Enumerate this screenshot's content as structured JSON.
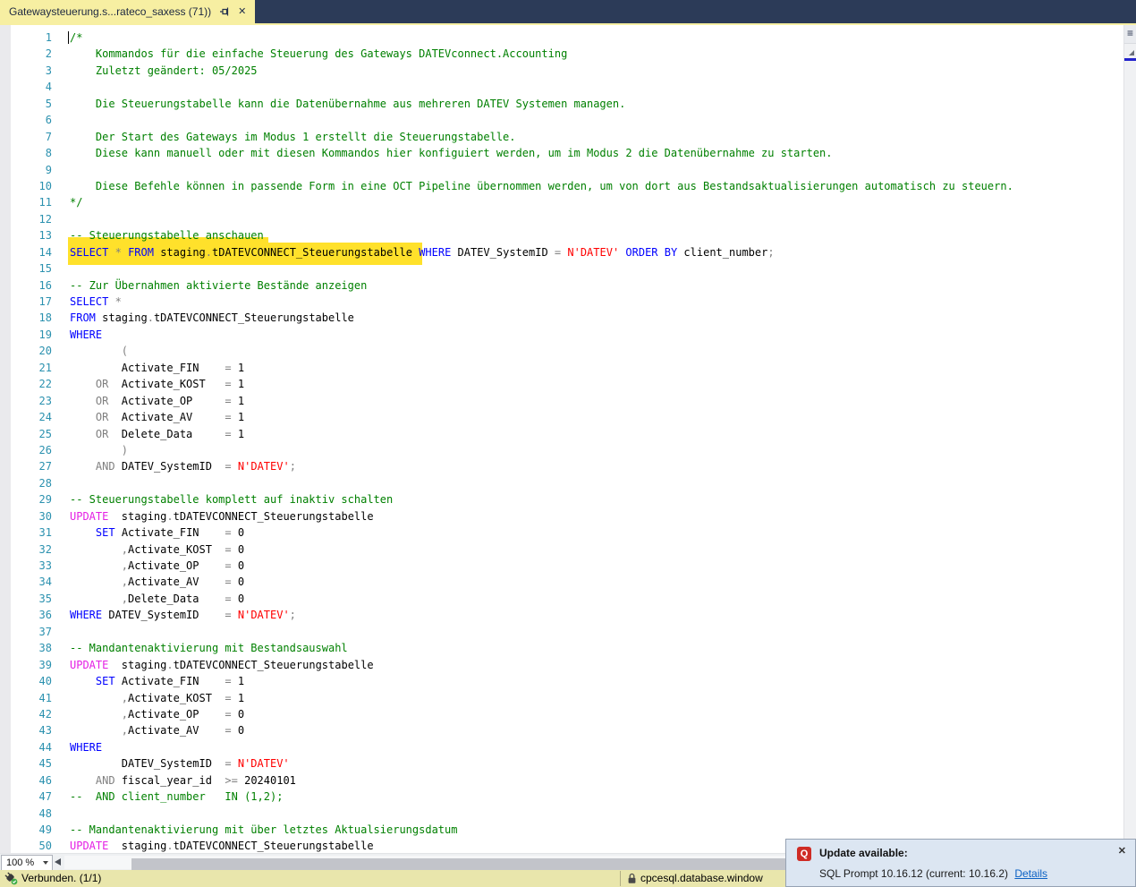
{
  "tab": {
    "title": "Gatewaysteuerung.s...rateco_saxess (71))",
    "close_glyph": "✕"
  },
  "editor": {
    "zoom_level": "100 %",
    "annotations": {
      "highlighted_line": 14
    },
    "lines": [
      {
        "n": 1,
        "t": [
          [
            "c",
            "/*"
          ]
        ]
      },
      {
        "n": 2,
        "t": [
          [
            "c",
            "    Kommandos für die einfache Steuerung des Gateways DATEVconnect.Accounting"
          ]
        ]
      },
      {
        "n": 3,
        "t": [
          [
            "c",
            "    Zuletzt geändert: 05/2025"
          ]
        ]
      },
      {
        "n": 4,
        "t": []
      },
      {
        "n": 5,
        "t": [
          [
            "c",
            "    Die Steuerungstabelle kann die Datenübernahme aus mehreren DATEV Systemen managen."
          ]
        ]
      },
      {
        "n": 6,
        "t": []
      },
      {
        "n": 7,
        "t": [
          [
            "c",
            "    Der Start des Gateways im Modus 1 erstellt die Steuerungstabelle."
          ]
        ]
      },
      {
        "n": 8,
        "t": [
          [
            "c",
            "    Diese kann manuell oder mit diesen Kommandos hier konfiguiert werden, um im Modus 2 die Datenübernahme zu starten."
          ]
        ]
      },
      {
        "n": 9,
        "t": []
      },
      {
        "n": 10,
        "t": [
          [
            "c",
            "    Diese Befehle können in passende Form in eine OCT Pipeline übernommen werden, um von dort aus Bestandsaktualisierungen automatisch zu steuern."
          ]
        ]
      },
      {
        "n": 11,
        "t": [
          [
            "c",
            "*/"
          ]
        ]
      },
      {
        "n": 12,
        "t": []
      },
      {
        "n": 13,
        "t": [
          [
            "c",
            "-- Steuerungstabelle anschauen"
          ]
        ]
      },
      {
        "n": 14,
        "t": [
          [
            "k",
            "SELECT"
          ],
          [
            "t",
            " "
          ],
          [
            "o",
            "*"
          ],
          [
            "t",
            " "
          ],
          [
            "k",
            "FROM"
          ],
          [
            "t",
            " staging"
          ],
          [
            "o",
            "."
          ],
          [
            "t",
            "tDATEVCONNECT_Steuerungstabelle "
          ],
          [
            "k",
            "WHERE"
          ],
          [
            "t",
            " DATEV_SystemID "
          ],
          [
            "o",
            "="
          ],
          [
            "t",
            " "
          ],
          [
            "s",
            "N'DATEV'"
          ],
          [
            "t",
            " "
          ],
          [
            "k",
            "ORDER BY"
          ],
          [
            "t",
            " client_number"
          ],
          [
            "o",
            ";"
          ]
        ]
      },
      {
        "n": 15,
        "t": []
      },
      {
        "n": 16,
        "t": [
          [
            "c",
            "-- Zur Übernahmen aktivierte Bestände anzeigen"
          ]
        ]
      },
      {
        "n": 17,
        "t": [
          [
            "k",
            "SELECT"
          ],
          [
            "t",
            " "
          ],
          [
            "o",
            "*"
          ]
        ]
      },
      {
        "n": 18,
        "t": [
          [
            "k",
            "FROM"
          ],
          [
            "t",
            " staging"
          ],
          [
            "o",
            "."
          ],
          [
            "t",
            "tDATEVCONNECT_Steuerungstabelle"
          ]
        ]
      },
      {
        "n": 19,
        "t": [
          [
            "k",
            "WHERE"
          ]
        ]
      },
      {
        "n": 20,
        "t": [
          [
            "t",
            "        "
          ],
          [
            "o",
            "("
          ]
        ]
      },
      {
        "n": 21,
        "t": [
          [
            "t",
            "        Activate_FIN    "
          ],
          [
            "o",
            "="
          ],
          [
            "t",
            " 1"
          ]
        ]
      },
      {
        "n": 22,
        "t": [
          [
            "t",
            "    "
          ],
          [
            "o",
            "OR"
          ],
          [
            "t",
            "  Activate_KOST   "
          ],
          [
            "o",
            "="
          ],
          [
            "t",
            " 1"
          ]
        ]
      },
      {
        "n": 23,
        "t": [
          [
            "t",
            "    "
          ],
          [
            "o",
            "OR"
          ],
          [
            "t",
            "  Activate_OP     "
          ],
          [
            "o",
            "="
          ],
          [
            "t",
            " 1"
          ]
        ]
      },
      {
        "n": 24,
        "t": [
          [
            "t",
            "    "
          ],
          [
            "o",
            "OR"
          ],
          [
            "t",
            "  Activate_AV     "
          ],
          [
            "o",
            "="
          ],
          [
            "t",
            " 1"
          ]
        ]
      },
      {
        "n": 25,
        "t": [
          [
            "t",
            "    "
          ],
          [
            "o",
            "OR"
          ],
          [
            "t",
            "  Delete_Data     "
          ],
          [
            "o",
            "="
          ],
          [
            "t",
            " 1"
          ]
        ]
      },
      {
        "n": 26,
        "t": [
          [
            "t",
            "        "
          ],
          [
            "o",
            ")"
          ]
        ]
      },
      {
        "n": 27,
        "t": [
          [
            "t",
            "    "
          ],
          [
            "o",
            "AND"
          ],
          [
            "t",
            " DATEV_SystemID  "
          ],
          [
            "o",
            "="
          ],
          [
            "t",
            " "
          ],
          [
            "s",
            "N'DATEV'"
          ],
          [
            "o",
            ";"
          ]
        ]
      },
      {
        "n": 28,
        "t": []
      },
      {
        "n": 29,
        "t": [
          [
            "c",
            "-- Steuerungstabelle komplett auf inaktiv schalten"
          ]
        ]
      },
      {
        "n": 30,
        "t": [
          [
            "m",
            "UPDATE"
          ],
          [
            "t",
            "  staging"
          ],
          [
            "o",
            "."
          ],
          [
            "t",
            "tDATEVCONNECT_Steuerungstabelle"
          ]
        ]
      },
      {
        "n": 31,
        "t": [
          [
            "t",
            "    "
          ],
          [
            "k",
            "SET"
          ],
          [
            "t",
            " Activate_FIN    "
          ],
          [
            "o",
            "="
          ],
          [
            "t",
            " 0"
          ]
        ]
      },
      {
        "n": 32,
        "t": [
          [
            "t",
            "        "
          ],
          [
            "o",
            ","
          ],
          [
            "t",
            "Activate_KOST  "
          ],
          [
            "o",
            "="
          ],
          [
            "t",
            " 0"
          ]
        ]
      },
      {
        "n": 33,
        "t": [
          [
            "t",
            "        "
          ],
          [
            "o",
            ","
          ],
          [
            "t",
            "Activate_OP    "
          ],
          [
            "o",
            "="
          ],
          [
            "t",
            " 0"
          ]
        ]
      },
      {
        "n": 34,
        "t": [
          [
            "t",
            "        "
          ],
          [
            "o",
            ","
          ],
          [
            "t",
            "Activate_AV    "
          ],
          [
            "o",
            "="
          ],
          [
            "t",
            " 0"
          ]
        ]
      },
      {
        "n": 35,
        "t": [
          [
            "t",
            "        "
          ],
          [
            "o",
            ","
          ],
          [
            "t",
            "Delete_Data    "
          ],
          [
            "o",
            "="
          ],
          [
            "t",
            " 0"
          ]
        ]
      },
      {
        "n": 36,
        "t": [
          [
            "k",
            "WHERE"
          ],
          [
            "t",
            " DATEV_SystemID    "
          ],
          [
            "o",
            "="
          ],
          [
            "t",
            " "
          ],
          [
            "s",
            "N'DATEV'"
          ],
          [
            "o",
            ";"
          ]
        ]
      },
      {
        "n": 37,
        "t": []
      },
      {
        "n": 38,
        "t": [
          [
            "c",
            "-- Mandantenaktivierung mit Bestandsauswahl"
          ]
        ]
      },
      {
        "n": 39,
        "t": [
          [
            "m",
            "UPDATE"
          ],
          [
            "t",
            "  staging"
          ],
          [
            "o",
            "."
          ],
          [
            "t",
            "tDATEVCONNECT_Steuerungstabelle"
          ]
        ]
      },
      {
        "n": 40,
        "t": [
          [
            "t",
            "    "
          ],
          [
            "k",
            "SET"
          ],
          [
            "t",
            " Activate_FIN    "
          ],
          [
            "o",
            "="
          ],
          [
            "t",
            " 1"
          ]
        ]
      },
      {
        "n": 41,
        "t": [
          [
            "t",
            "        "
          ],
          [
            "o",
            ","
          ],
          [
            "t",
            "Activate_KOST  "
          ],
          [
            "o",
            "="
          ],
          [
            "t",
            " 1"
          ]
        ]
      },
      {
        "n": 42,
        "t": [
          [
            "t",
            "        "
          ],
          [
            "o",
            ","
          ],
          [
            "t",
            "Activate_OP    "
          ],
          [
            "o",
            "="
          ],
          [
            "t",
            " 0"
          ]
        ]
      },
      {
        "n": 43,
        "t": [
          [
            "t",
            "        "
          ],
          [
            "o",
            ","
          ],
          [
            "t",
            "Activate_AV    "
          ],
          [
            "o",
            "="
          ],
          [
            "t",
            " 0"
          ]
        ]
      },
      {
        "n": 44,
        "t": [
          [
            "k",
            "WHERE"
          ]
        ]
      },
      {
        "n": 45,
        "t": [
          [
            "t",
            "        DATEV_SystemID  "
          ],
          [
            "o",
            "="
          ],
          [
            "t",
            " "
          ],
          [
            "s",
            "N'DATEV'"
          ]
        ]
      },
      {
        "n": 46,
        "t": [
          [
            "t",
            "    "
          ],
          [
            "o",
            "AND"
          ],
          [
            "t",
            " fiscal_year_id  "
          ],
          [
            "o",
            ">="
          ],
          [
            "t",
            " 20240101"
          ]
        ]
      },
      {
        "n": 47,
        "t": [
          [
            "c",
            "--  AND client_number   IN (1,2);"
          ]
        ]
      },
      {
        "n": 48,
        "t": []
      },
      {
        "n": 49,
        "t": [
          [
            "c",
            "-- Mandantenaktivierung mit über letztes Aktualsierungsdatum"
          ]
        ]
      },
      {
        "n": 50,
        "t": [
          [
            "m",
            "UPDATE"
          ],
          [
            "t",
            "  staging"
          ],
          [
            "o",
            "."
          ],
          [
            "t",
            "tDATEVCONNECT_Steuerungstabelle"
          ]
        ]
      }
    ]
  },
  "scrollbar": {
    "options_glyph": "≡"
  },
  "status_bar": {
    "connection": "Verbunden. (1/1)",
    "server": "cpcesql.database.window"
  },
  "notification": {
    "title": "Update available:",
    "body": "SQL Prompt 10.16.12 (current: 10.16.2)",
    "link": "Details",
    "icon_letter": "Q",
    "close_glyph": "✕"
  },
  "colors": {
    "keyword": "#0000ff",
    "keyword2": "#e521e5",
    "comment": "#008000",
    "string": "#ff0000",
    "operator": "#808080",
    "plain": "#000000",
    "lineno": "#2b91af",
    "marker": "#ffe12b",
    "tab_bg": "#f7efa2",
    "tabstrip_bg": "#2c3b58",
    "status_bg": "#e9e6ac",
    "popup_bg": "#dce6f2",
    "link": "#0b61c4"
  }
}
